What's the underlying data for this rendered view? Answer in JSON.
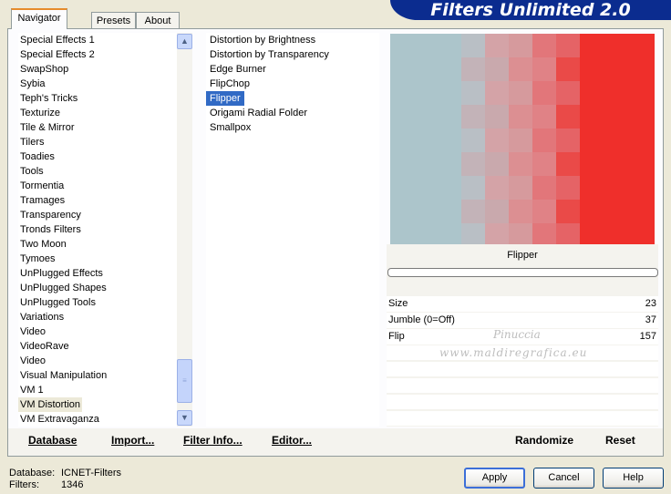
{
  "banner": {
    "title": "Filters Unlimited 2.0"
  },
  "tabs": [
    {
      "label": "Navigator",
      "active": true
    },
    {
      "label": "Presets",
      "active": false
    },
    {
      "label": "About",
      "active": false
    }
  ],
  "categories": {
    "items": [
      "Special Effects 1",
      "Special Effects 2",
      "SwapShop",
      "Sybia",
      "Teph's Tricks",
      "Texturize",
      "Tile & Mirror",
      "Tilers",
      "Toadies",
      "Tools",
      "Tormentia",
      "Tramages",
      "Transparency",
      "Tronds Filters",
      "Two Moon",
      "Tymoes",
      "UnPlugged Effects",
      "UnPlugged Shapes",
      "UnPlugged Tools",
      "Variations",
      "Video",
      "VideoRave",
      "Video",
      "Visual Manipulation",
      "VM 1",
      "VM Distortion",
      "VM Extravaganza"
    ],
    "selected": "VM Distortion"
  },
  "filters": {
    "items": [
      "Distortion by Brightness",
      "Distortion by Transparency",
      "Edge Burner",
      "FlipChop",
      "Flipper",
      "Origami Radial Folder",
      "Smallpox"
    ],
    "selected": "Flipper"
  },
  "preview": {
    "filter_name": "Flipper"
  },
  "params": [
    {
      "name": "Size",
      "value": "23"
    },
    {
      "name": "Jumble (0=Off)",
      "value": "37"
    },
    {
      "name": "Flip",
      "value": "157"
    }
  ],
  "watermark": {
    "line1": "Pinuccia",
    "line2": "www.maldiregrafica.eu"
  },
  "toolbar": {
    "database": "Database",
    "import": "Import...",
    "filter_info": "Filter Info...",
    "editor": "Editor...",
    "randomize": "Randomize",
    "reset": "Reset"
  },
  "status": {
    "database_label": "Database:",
    "database_value": "ICNET-Filters",
    "filters_label": "Filters:",
    "filters_value": "1346"
  },
  "buttons": {
    "apply": "Apply",
    "cancel": "Cancel",
    "help": "Help"
  },
  "colors": {
    "banner": "#0b2c8f",
    "selection": "#316ac5",
    "preview_left": "#acc5cb",
    "preview_right": "#ef2f2b"
  }
}
